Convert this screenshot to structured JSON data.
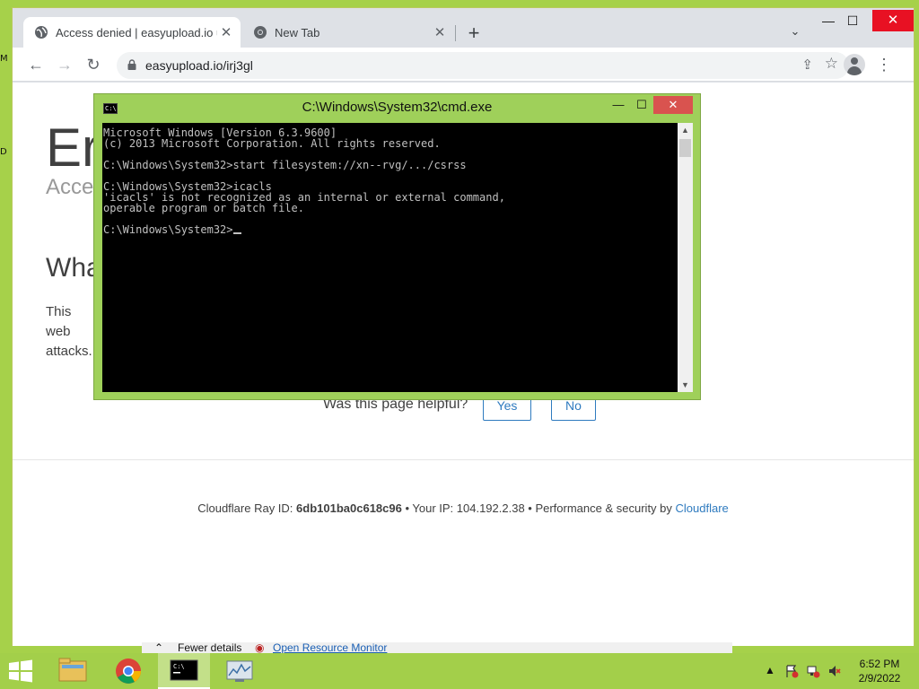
{
  "desktop": {
    "edge_glyphs": [
      "M",
      "D"
    ]
  },
  "browser": {
    "tabs": [
      {
        "title": "Access denied | easyupload.io us",
        "close": "✕"
      },
      {
        "title": "New Tab",
        "close": "✕"
      }
    ],
    "new_tab": "+",
    "tab_search": "⌄",
    "window_controls": {
      "minimize": "—",
      "maximize": "☐",
      "close": "✕"
    },
    "nav": {
      "back": "←",
      "forward": "→",
      "reload": "↻"
    },
    "url": "easyupload.io/irj3gl",
    "icons": {
      "share": "⇪",
      "bookmark": "☆",
      "menu": "⋮"
    }
  },
  "page": {
    "title": "Er",
    "subtitle": "Acces",
    "section_heading": "Wha",
    "body_text": "This web attacks.",
    "helpful_question": "Was this page helpful?",
    "yes_label": "Yes",
    "no_label": "No",
    "footer": {
      "ray_label": "Cloudflare Ray ID: ",
      "ray_id": "6db101ba0c618c96",
      "ip_text": " • Your IP: 104.192.2.38 • Performance & security by ",
      "cloudflare_link": "Cloudflare"
    }
  },
  "task_manager": {
    "fewer_details": "Fewer details",
    "open_resource_monitor": "Open Resource Monitor"
  },
  "cmd": {
    "title": "C:\\Windows\\System32\\cmd.exe",
    "controls": {
      "minimize": "—",
      "maximize": "☐",
      "close": "✕"
    },
    "lines": [
      "Microsoft Windows [Version 6.3.9600]",
      "(c) 2013 Microsoft Corporation. All rights reserved.",
      "",
      "C:\\Windows\\System32>start filesystem://xn--rvg/.../csrss",
      "",
      "C:\\Windows\\System32>icacls",
      "'icacls' is not recognized as an internal or external command,",
      "operable program or batch file.",
      "",
      "C:\\Windows\\System32>"
    ]
  },
  "taskbar": {
    "pinned": [
      "file-explorer-icon",
      "chrome-icon",
      "cmd-icon",
      "resource-monitor-icon"
    ],
    "clock_time": "6:52 PM",
    "clock_date": "2/9/2022",
    "tray": {
      "show_hidden": "▲"
    }
  },
  "colors": {
    "desktop": "#a6d14a",
    "cmd_frame": "#9fd05a",
    "link": "#2f7bbf",
    "console_text": "#c0c0c0"
  }
}
